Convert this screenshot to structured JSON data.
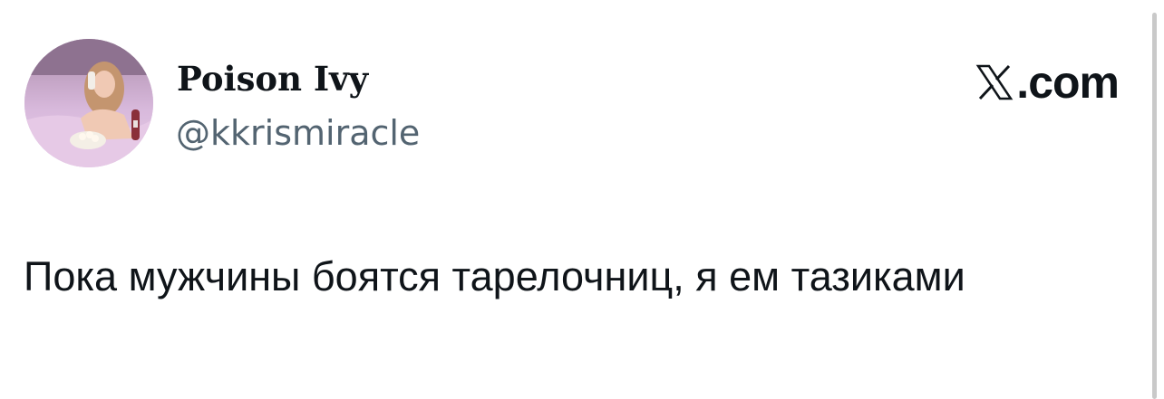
{
  "tweet": {
    "author": {
      "display_name": "Poison Ivy",
      "handle": "@kkrismiracle",
      "avatar": "avatar-photo"
    },
    "source_logo": {
      "icon": "x-logo-icon",
      "text": ".com"
    },
    "text": "Пока мужчины боятся тарелочниц, я ем тазиками"
  }
}
